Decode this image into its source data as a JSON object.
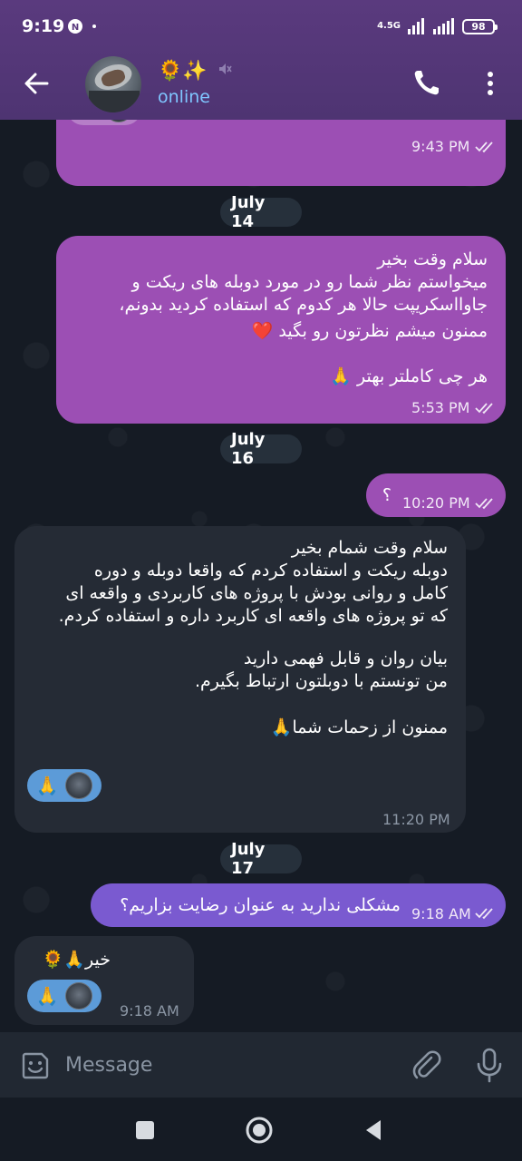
{
  "status_bar": {
    "time": "9:19",
    "network": "4.5G",
    "battery": "98"
  },
  "header": {
    "name_emoji": "🌻✨",
    "status": "online"
  },
  "messages": [
    {
      "id": "m1",
      "time": "9:43 PM",
      "reaction": "🙏"
    },
    {
      "id": "m2",
      "lines": [
        "سلام وقت بخیر",
        "میخواستم نظر شما رو در مورد دوبله های ریکت و",
        "جاوااسکریپت حالا هر کدوم که استفاده کردید بدونم،",
        "ممنون میشم نظرتون رو بگید ❤️",
        "",
        "هر چی کاملتر بهتر 🙏"
      ],
      "time": "5:53 PM"
    },
    {
      "id": "m3",
      "text": "؟",
      "time": "10:20 PM"
    },
    {
      "id": "m4",
      "lines": [
        "سلام وقت شمام بخیر",
        "دوبله ریکت و استفاده کردم که واقعا دوبله و دوره",
        "کامل و روانی بودش با پروژه های کاربردی و واقعه ای",
        "که تو پروژه های واقعه ای کاربرد داره و استفاده کردم.",
        "",
        "بیان روان و قابل فهمی دارید",
        "من تونستم با دوبلتون ارتباط بگیرم.",
        "",
        "ممنون از زحمات شما🙏"
      ],
      "time": "11:20 PM",
      "reaction": "🙏"
    },
    {
      "id": "m5",
      "text": "مشکلی ندارید به عنوان رضایت بزاریم؟",
      "time": "9:18 AM"
    },
    {
      "id": "m6",
      "text": "خیر🙏🌻",
      "time": "9:18 AM",
      "reaction": "🙏"
    }
  ],
  "dates": [
    "July 14",
    "July 16",
    "July 17"
  ],
  "input": {
    "placeholder": "Message"
  },
  "colors": {
    "header": "#5a3a7e",
    "outgoing": "#9c4fb4",
    "incoming": "#252b35",
    "online": "#7fc6ff"
  }
}
